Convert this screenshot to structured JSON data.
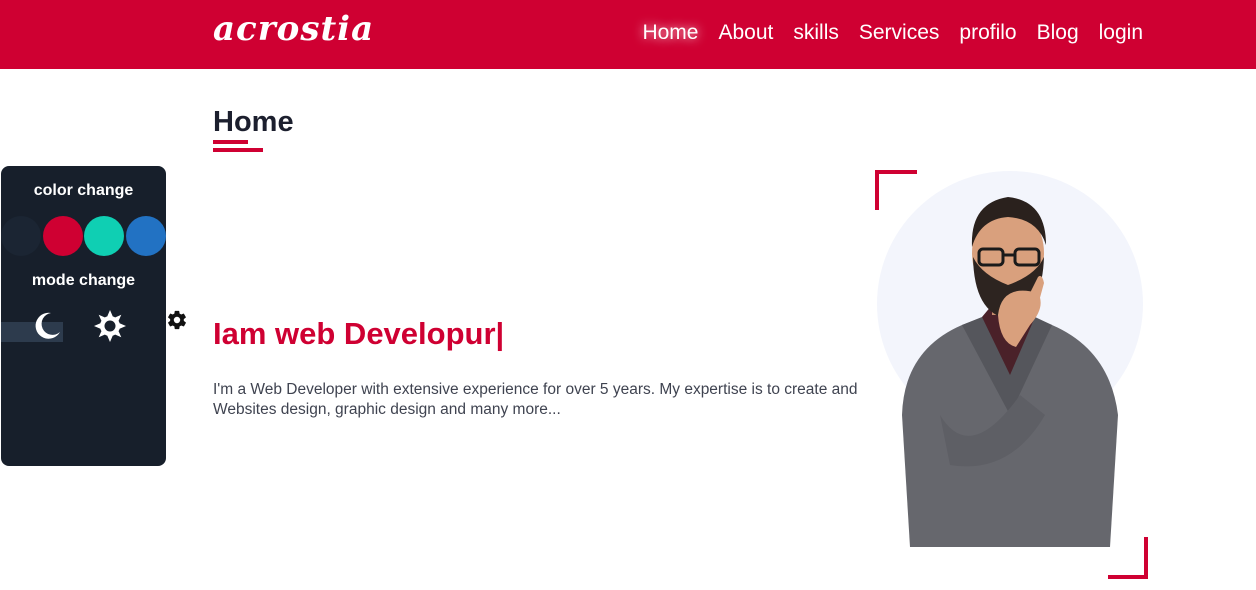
{
  "brand": {
    "logo_text": "acrostia",
    "accent_color": "#cf0032"
  },
  "nav": {
    "items": [
      {
        "label": "Home",
        "active": true
      },
      {
        "label": "About",
        "active": false
      },
      {
        "label": "skills",
        "active": false
      },
      {
        "label": "Services",
        "active": false
      },
      {
        "label": "profilo",
        "active": false
      },
      {
        "label": "Blog",
        "active": false
      },
      {
        "label": "login",
        "active": false
      }
    ]
  },
  "section": {
    "title": "Home"
  },
  "hero": {
    "headline": "Iam web Developur",
    "typing_cursor": "|",
    "description": "I'm a Web Developer with extensive experience for over 5 years. My expertise is to create and Websites design, graphic design and many more..."
  },
  "style_panel": {
    "color_heading": "color change",
    "mode_heading": "mode change",
    "swatches": [
      {
        "name": "dark-navy",
        "color": "#1b2533"
      },
      {
        "name": "crimson",
        "color": "#cf0032"
      },
      {
        "name": "teal",
        "color": "#0fcfb3"
      },
      {
        "name": "blue",
        "color": "#2272c3"
      }
    ],
    "mode_icons": [
      "moon-icon",
      "sun-icon"
    ],
    "toggle_icon": "gear-icon"
  },
  "portrait": {
    "icon": "person-portrait",
    "bg_circle_color": "#f3f5fc"
  }
}
